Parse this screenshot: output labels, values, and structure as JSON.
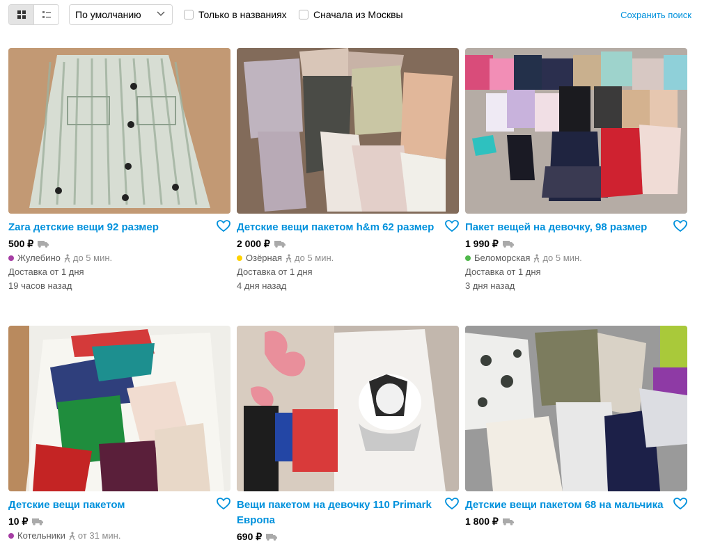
{
  "toolbar": {
    "sort_value": "По умолчанию",
    "only_titles_label": "Только в названиях",
    "moscow_first_label": "Сначала из Москвы",
    "save_search_label": "Сохранить поиск"
  },
  "colors": {
    "link": "#0091dc",
    "metro_purple": "#a63ea4",
    "metro_yellow": "#ffd200",
    "metro_green": "#4fb84b"
  },
  "listings": [
    {
      "title": "Zara детские вещи 92 размер",
      "price": "500 ₽",
      "metro": "Жулебино",
      "time": "до 5 мин.",
      "delivery": "Доставка от 1 дня",
      "posted": "19 часов назад"
    },
    {
      "title": "Детские вещи пакетом h&m 62 размер",
      "price": "2 000 ₽",
      "metro": "Озёрная",
      "time": "до 5 мин.",
      "delivery": "Доставка от 1 дня",
      "posted": "4 дня назад"
    },
    {
      "title": "Пакет вещей на девочку, 98 размер",
      "price": "1 990 ₽",
      "metro": "Беломорская",
      "time": "до 5 мин.",
      "delivery": "Доставка от 1 дня",
      "posted": "3 дня назад"
    },
    {
      "title": "Детские вещи пакетом",
      "price": "10 ₽",
      "metro": "Котельники",
      "time": "от 31 мин."
    },
    {
      "title": "Вещи пакетом на девочку 110 Primark Европа",
      "price": "690 ₽"
    },
    {
      "title": "Детские вещи пакетом 68 на мальчика",
      "price": "1 800 ₽"
    }
  ]
}
